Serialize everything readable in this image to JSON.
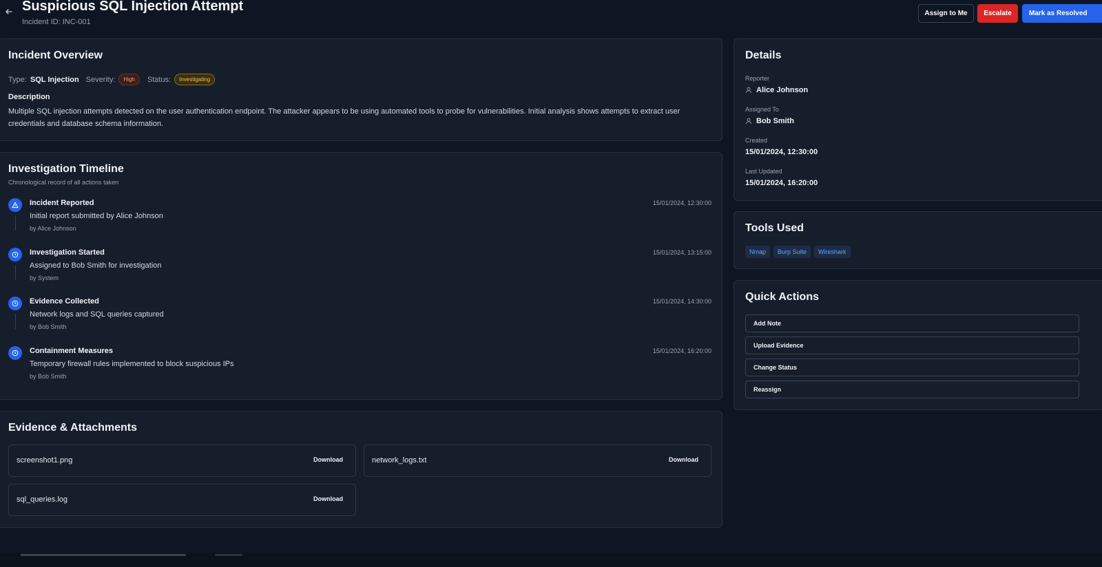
{
  "header": {
    "title": "Suspicious SQL Injection Attempt",
    "incident_id": "Incident ID: INC-001",
    "buttons": {
      "assign": "Assign to Me",
      "escalate": "Escalate",
      "resolve": "Mark as Resolved"
    }
  },
  "overview": {
    "title": "Incident Overview",
    "type_label": "Type:",
    "type_value": "SQL Injection",
    "severity_label": "Severity:",
    "severity_value": "High",
    "status_label": "Status:",
    "status_value": "Investigating",
    "description_label": "Description",
    "description": "Multiple SQL injection attempts detected on the user authentication endpoint. The attacker appears to be using automated tools to probe for vulnerabilities. Initial analysis shows attempts to extract user credentials and database schema information."
  },
  "timeline": {
    "title": "Investigation Timeline",
    "subtitle": "Chronological record of all actions taken",
    "items": [
      {
        "title": "Incident Reported",
        "description": "Initial report submitted by Alice Johnson",
        "by": "by Alice Johnson",
        "time": "15/01/2024, 12:30:00",
        "icon": "alert-triangle-icon"
      },
      {
        "title": "Investigation Started",
        "description": "Assigned to Bob Smith for investigation",
        "by": "by System",
        "time": "15/01/2024, 13:15:00",
        "icon": "clock-icon"
      },
      {
        "title": "Evidence Collected",
        "description": "Network logs and SQL queries captured",
        "by": "by Bob Smith",
        "time": "15/01/2024, 14:30:00",
        "icon": "clock-icon"
      },
      {
        "title": "Containment Measures",
        "description": "Temporary firewall rules implemented to block suspicious IPs",
        "by": "by Bob Smith",
        "time": "15/01/2024, 16:20:00",
        "icon": "clock-icon"
      }
    ]
  },
  "evidence": {
    "title": "Evidence & Attachments",
    "download_label": "Download",
    "files": [
      "screenshot1.png",
      "network_logs.txt",
      "sql_queries.log"
    ]
  },
  "details": {
    "title": "Details",
    "reporter_label": "Reporter",
    "reporter": "Alice Johnson",
    "assigned_label": "Assigned To",
    "assigned": "Bob Smith",
    "created_label": "Created",
    "created": "15/01/2024, 12:30:00",
    "updated_label": "Last Updated",
    "updated": "15/01/2024, 16:20:00"
  },
  "tools": {
    "title": "Tools Used",
    "items": [
      "Nmap",
      "Burp Suite",
      "Wireshark"
    ]
  },
  "quick_actions": {
    "title": "Quick Actions",
    "items": [
      "Add Note",
      "Upload Evidence",
      "Change Status",
      "Reassign"
    ]
  },
  "colors": {
    "background": "#0f1623",
    "card": "#161e2b",
    "primary": "#2563eb",
    "danger": "#dc2626",
    "severity_high": "#f59e7b",
    "status_investigating": "#f2c14e"
  }
}
